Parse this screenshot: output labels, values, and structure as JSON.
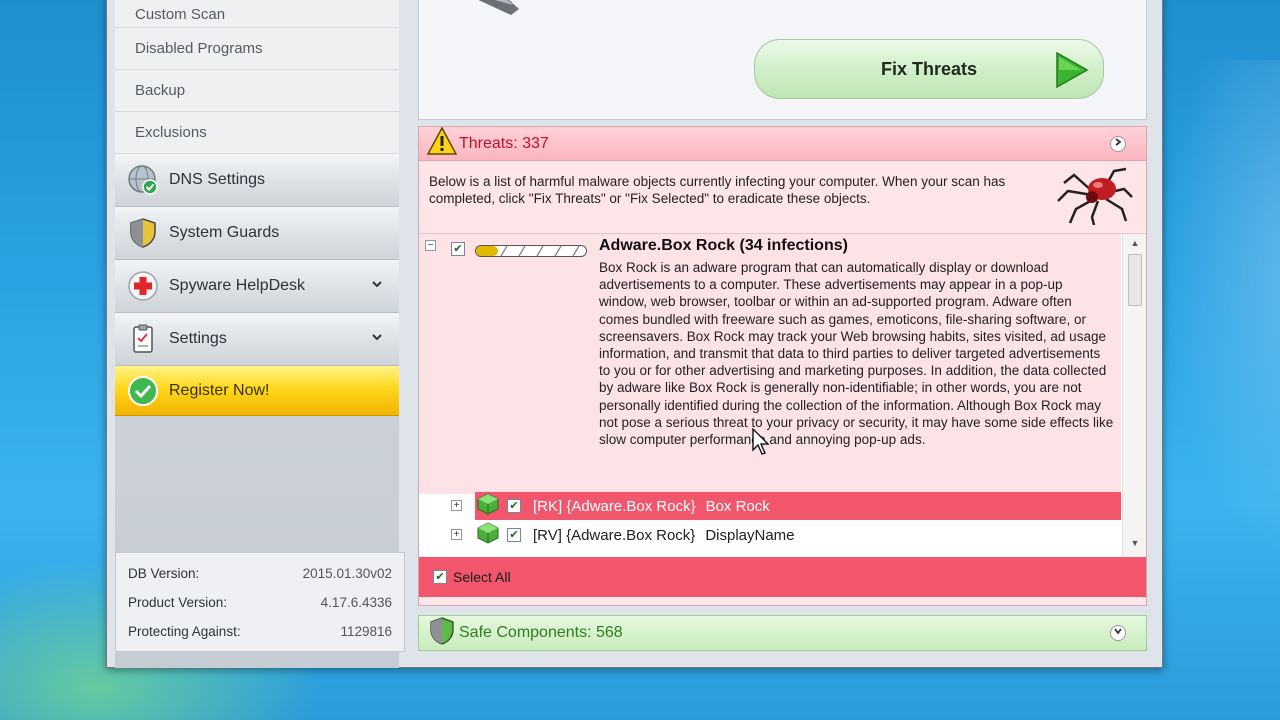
{
  "sidebar": {
    "sub_items": [
      {
        "label": "Custom Scan"
      },
      {
        "label": "Disabled Programs"
      },
      {
        "label": "Backup"
      },
      {
        "label": "Exclusions"
      }
    ],
    "nav_items": [
      {
        "label": "DNS Settings",
        "icon": "globe-check-icon"
      },
      {
        "label": "System Guards",
        "icon": "shield-icon"
      },
      {
        "label": "Spyware HelpDesk",
        "icon": "red-cross-icon"
      },
      {
        "label": "Settings",
        "icon": "clipboard-icon"
      }
    ],
    "register_label": "Register Now!",
    "info": {
      "db_version_label": "DB Version:",
      "db_version_value": "2015.01.30v02",
      "product_version_label": "Product Version:",
      "product_version_value": "4.17.6.4336",
      "protecting_label": "Protecting Against:",
      "protecting_value": "1129816"
    }
  },
  "main": {
    "fix_button_label": "Fix Threats",
    "threats": {
      "header": "Threats: 337",
      "description": "Below is a list of harmful malware objects currently infecting your computer. When your scan has completed, click \"Fix Threats\" or \"Fix Selected\" to eradicate these objects.",
      "detail_title": "Adware.Box Rock (34 infections)",
      "detail_text": "Box Rock is an adware program that can automatically display or download advertisements to a computer. These advertisements may appear in a pop-up window, web browser, toolbar or within an ad-supported program. Adware often comes bundled with freeware such as games, emoticons, file-sharing software, or screensavers. Box Rock may track your Web browsing habits, sites visited, ad usage information, and transmit that data to third parties to deliver targeted advertisements to you or for other advertising and marketing purposes. In addition, the data collected by adware like Box Rock is generally non-identifiable; in other words, you are not personally identified during the collection of the information. Although Box Rock may not pose a serious threat to your privacy or security, it may have some side effects like slow computer performance and annoying pop-up ads.",
      "rows": [
        {
          "tag": "[RK] {Adware.Box Rock}",
          "name": "Box Rock"
        },
        {
          "tag": "[RV] {Adware.Box Rock}",
          "name": "DisplayName"
        }
      ],
      "select_all_label": "Select All"
    },
    "safe_components": "Safe Components: 568"
  },
  "colors": {
    "threat_red": "#c0112a",
    "row_highlight": "#f2566c",
    "safe_green": "#2e7d1e",
    "register_yellow": "#ffd81e"
  }
}
